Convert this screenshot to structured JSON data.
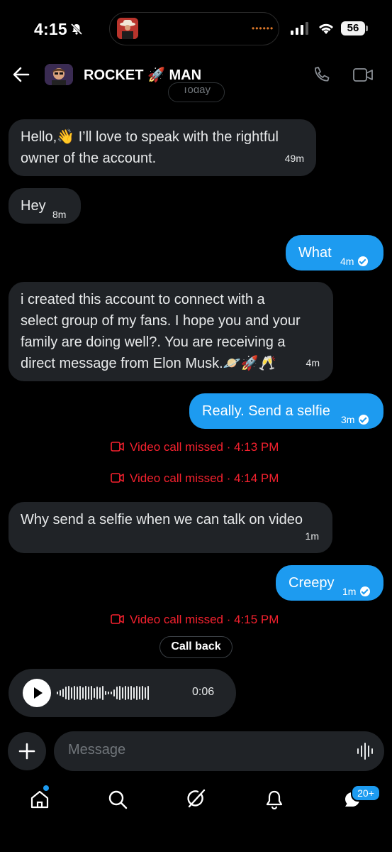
{
  "status_bar": {
    "time": "4:15",
    "battery": "56"
  },
  "header": {
    "title": "ROCKET 🚀 MAN"
  },
  "today_label": "Today",
  "messages": [
    {
      "type": "in",
      "text_lines": [
        "Hello,👋 I’ll love to speak with the rightful",
        "owner of the account."
      ],
      "time": "49m"
    },
    {
      "type": "in",
      "text": "Hey",
      "time": "8m"
    },
    {
      "type": "out",
      "text": "What",
      "time": "4m"
    },
    {
      "type": "in",
      "text_lines": [
        "i created this account to connect with a",
        "select group of my fans. I hope you and your",
        "family are doing well?. You are receiving a",
        "direct message from Elon Musk.🪐🚀🥂"
      ],
      "time": "4m"
    },
    {
      "type": "out",
      "text": "Really. Send a selfie",
      "time": "3m"
    },
    {
      "type": "missed",
      "text": "Video call missed · 4:13 PM"
    },
    {
      "type": "missed",
      "text": "Video call missed · 4:14 PM"
    },
    {
      "type": "in",
      "text": "Why send a selfie when we can talk on video",
      "time": "1m"
    },
    {
      "type": "out",
      "text": "Creepy",
      "time": "1m"
    },
    {
      "type": "missed",
      "text": "Video call missed · 4:15 PM"
    }
  ],
  "call_back_label": "Call back",
  "voice_message": {
    "duration": "0:06"
  },
  "composer": {
    "placeholder": "Message"
  },
  "bottom_nav": {
    "messages_badge": "20+"
  },
  "colors": {
    "accent": "#1d9bf0",
    "missed": "#f4212e",
    "bubble_in": "#202327",
    "background": "#000000"
  }
}
